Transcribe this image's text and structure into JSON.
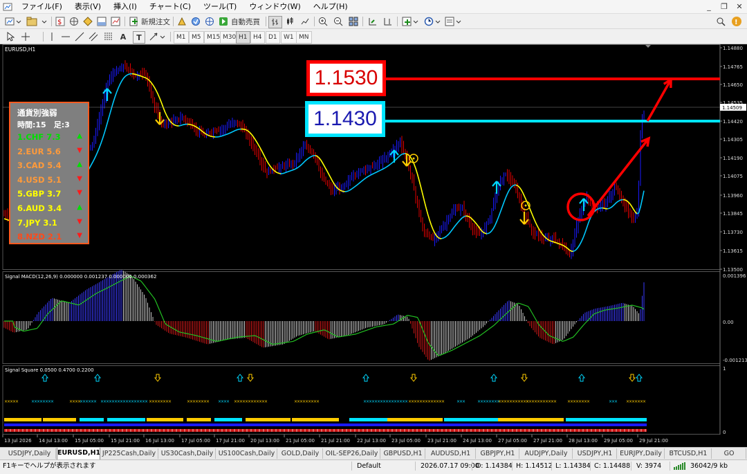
{
  "menu": [
    "ファイル(F)",
    "表示(V)",
    "挿入(I)",
    "チャート(C)",
    "ツール(T)",
    "ウィンドウ(W)",
    "ヘルプ(H)"
  ],
  "window_controls": [
    "_",
    "❐",
    "✕"
  ],
  "toolbar": {
    "new_order_label": "新規注文",
    "auto_trade_label": "自動売買",
    "periods": [
      "M1",
      "M5",
      "M15",
      "M30",
      "H1",
      "H4",
      "D1",
      "W1",
      "MN"
    ],
    "active_period": "H1",
    "text_tool": "A",
    "label_tool": "T"
  },
  "chart": {
    "symbol_label": "EURUSD,H1",
    "price_axis": [
      "1.14880",
      "1.14765",
      "1.14650",
      "1.14535",
      "1.14420",
      "1.14305",
      "1.14190",
      "1.14075",
      "1.13960",
      "1.13845",
      "1.13730",
      "1.13615",
      "1.13500"
    ],
    "current_price": "1.14509",
    "time_axis": [
      "13 Jul 2026",
      "14 Jul 13:00",
      "15 Jul 05:00",
      "15 Jul 21:00",
      "16 Jul 13:00",
      "17 Jul 05:00",
      "17 Jul 21:00",
      "20 Jul 13:00",
      "21 Jul 05:00",
      "21 Jul 21:00",
      "22 Jul 13:00",
      "23 Jul 05:00",
      "23 Jul 21:00",
      "24 Jul 13:00",
      "27 Jul 05:00",
      "27 Jul 21:00",
      "28 Jul 13:00",
      "29 Jul 05:00",
      "29 Jul 21:00"
    ],
    "annotations": {
      "upper_price": "1.1530",
      "lower_price": "1.1430"
    }
  },
  "strength_panel": {
    "title": "通貨別強弱",
    "subtitle": "時間:15　足:3",
    "rows": [
      {
        "label": "1.CHF  7.3",
        "color": "#00e000",
        "arrow": "▲",
        "arrow_color": "#00e000"
      },
      {
        "label": "2.EUR  5.6",
        "color": "#ff9a3a",
        "arrow": "▼",
        "arrow_color": "#ff1a1a"
      },
      {
        "label": "3.CAD  5.4",
        "color": "#ff9a3a",
        "arrow": "▲",
        "arrow_color": "#00e000"
      },
      {
        "label": "4.USD  5.1",
        "color": "#ff9a3a",
        "arrow": "▼",
        "arrow_color": "#ff1a1a"
      },
      {
        "label": "5.GBP  3.7",
        "color": "#ffff00",
        "arrow": "▼",
        "arrow_color": "#ff1a1a"
      },
      {
        "label": "6.AUD  3.4",
        "color": "#ffff00",
        "arrow": "▲",
        "arrow_color": "#00e000"
      },
      {
        "label": "7.JPY  3.1",
        "color": "#ffff00",
        "arrow": "▼",
        "arrow_color": "#ff1a1a"
      },
      {
        "label": "8.NZD  2.1",
        "color": "#ff4a1a",
        "arrow": "▼",
        "arrow_color": "#ff1a1a"
      }
    ]
  },
  "macd": {
    "label": "Signal MACD(12,26,9) 0.000000 0.001237 0.000000 0.000362",
    "axis": [
      "0.001396",
      "0.00",
      "-0.001213"
    ]
  },
  "square": {
    "label": "Signal Square 0.0500 0.4700 0.2200",
    "axis": [
      "1",
      "0"
    ]
  },
  "tabs": [
    "USDJPY,Daily",
    "EURUSD,H1",
    "JP225Cash,Daily",
    "US30Cash,Daily",
    "US100Cash,Daily",
    "GOLD,Daily",
    "OIL-SEP26,Daily",
    "GBPUSD,H1",
    "AUDUSD,H1",
    "GBPJPY,H1",
    "AUDJPY,Daily",
    "USDJPY,H1",
    "EURJPY,Daily",
    "BTCUSD,H1",
    "GO"
  ],
  "active_tab": "EURUSD,H1",
  "status": {
    "help": "F1キーでヘルプが表示されます",
    "profile": "Default",
    "datetime": "2026.07.17 09:00",
    "open": "O: 1.14384",
    "high": "H: 1.14512",
    "low": "L: 1.14384",
    "close": "C: 1.14488",
    "volume": "V: 3974",
    "traffic": "36042/9 kb"
  },
  "colors": {
    "accent_red": "#ff0000",
    "accent_cyan": "#00e5ff",
    "bull_candle": "#1a1aff",
    "bear_candle": "#e00000",
    "ma_fast": "#ffff00",
    "ma_slow": "#00c8ff"
  }
}
